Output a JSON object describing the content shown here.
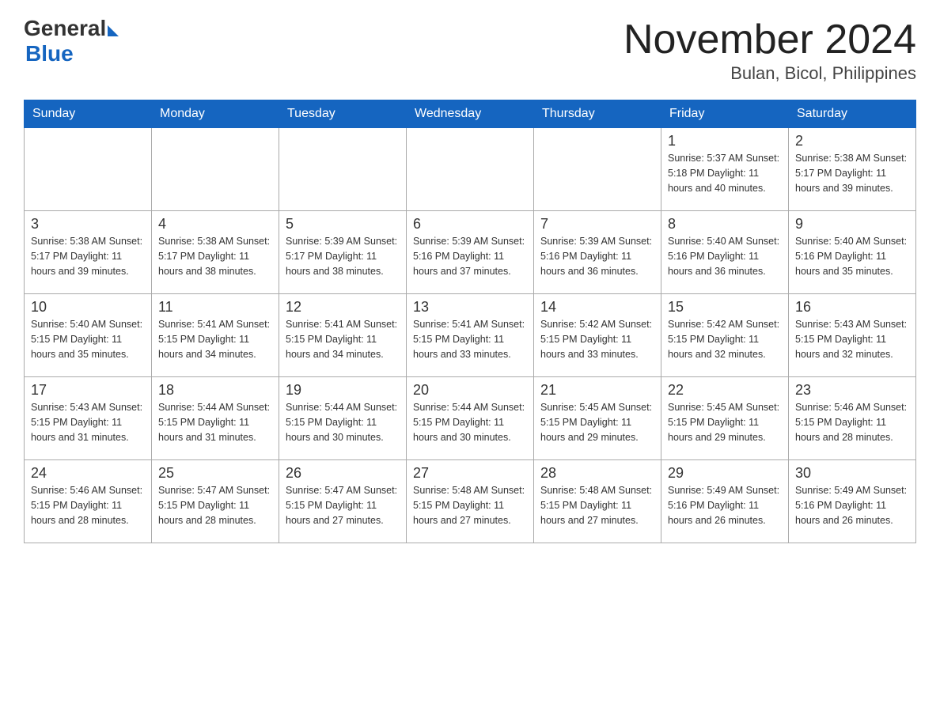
{
  "logo": {
    "general": "General",
    "blue": "Blue"
  },
  "header": {
    "month": "November 2024",
    "location": "Bulan, Bicol, Philippines"
  },
  "days_of_week": [
    "Sunday",
    "Monday",
    "Tuesday",
    "Wednesday",
    "Thursday",
    "Friday",
    "Saturday"
  ],
  "weeks": [
    [
      {
        "day": "",
        "info": ""
      },
      {
        "day": "",
        "info": ""
      },
      {
        "day": "",
        "info": ""
      },
      {
        "day": "",
        "info": ""
      },
      {
        "day": "",
        "info": ""
      },
      {
        "day": "1",
        "info": "Sunrise: 5:37 AM\nSunset: 5:18 PM\nDaylight: 11 hours and 40 minutes."
      },
      {
        "day": "2",
        "info": "Sunrise: 5:38 AM\nSunset: 5:17 PM\nDaylight: 11 hours and 39 minutes."
      }
    ],
    [
      {
        "day": "3",
        "info": "Sunrise: 5:38 AM\nSunset: 5:17 PM\nDaylight: 11 hours and 39 minutes."
      },
      {
        "day": "4",
        "info": "Sunrise: 5:38 AM\nSunset: 5:17 PM\nDaylight: 11 hours and 38 minutes."
      },
      {
        "day": "5",
        "info": "Sunrise: 5:39 AM\nSunset: 5:17 PM\nDaylight: 11 hours and 38 minutes."
      },
      {
        "day": "6",
        "info": "Sunrise: 5:39 AM\nSunset: 5:16 PM\nDaylight: 11 hours and 37 minutes."
      },
      {
        "day": "7",
        "info": "Sunrise: 5:39 AM\nSunset: 5:16 PM\nDaylight: 11 hours and 36 minutes."
      },
      {
        "day": "8",
        "info": "Sunrise: 5:40 AM\nSunset: 5:16 PM\nDaylight: 11 hours and 36 minutes."
      },
      {
        "day": "9",
        "info": "Sunrise: 5:40 AM\nSunset: 5:16 PM\nDaylight: 11 hours and 35 minutes."
      }
    ],
    [
      {
        "day": "10",
        "info": "Sunrise: 5:40 AM\nSunset: 5:15 PM\nDaylight: 11 hours and 35 minutes."
      },
      {
        "day": "11",
        "info": "Sunrise: 5:41 AM\nSunset: 5:15 PM\nDaylight: 11 hours and 34 minutes."
      },
      {
        "day": "12",
        "info": "Sunrise: 5:41 AM\nSunset: 5:15 PM\nDaylight: 11 hours and 34 minutes."
      },
      {
        "day": "13",
        "info": "Sunrise: 5:41 AM\nSunset: 5:15 PM\nDaylight: 11 hours and 33 minutes."
      },
      {
        "day": "14",
        "info": "Sunrise: 5:42 AM\nSunset: 5:15 PM\nDaylight: 11 hours and 33 minutes."
      },
      {
        "day": "15",
        "info": "Sunrise: 5:42 AM\nSunset: 5:15 PM\nDaylight: 11 hours and 32 minutes."
      },
      {
        "day": "16",
        "info": "Sunrise: 5:43 AM\nSunset: 5:15 PM\nDaylight: 11 hours and 32 minutes."
      }
    ],
    [
      {
        "day": "17",
        "info": "Sunrise: 5:43 AM\nSunset: 5:15 PM\nDaylight: 11 hours and 31 minutes."
      },
      {
        "day": "18",
        "info": "Sunrise: 5:44 AM\nSunset: 5:15 PM\nDaylight: 11 hours and 31 minutes."
      },
      {
        "day": "19",
        "info": "Sunrise: 5:44 AM\nSunset: 5:15 PM\nDaylight: 11 hours and 30 minutes."
      },
      {
        "day": "20",
        "info": "Sunrise: 5:44 AM\nSunset: 5:15 PM\nDaylight: 11 hours and 30 minutes."
      },
      {
        "day": "21",
        "info": "Sunrise: 5:45 AM\nSunset: 5:15 PM\nDaylight: 11 hours and 29 minutes."
      },
      {
        "day": "22",
        "info": "Sunrise: 5:45 AM\nSunset: 5:15 PM\nDaylight: 11 hours and 29 minutes."
      },
      {
        "day": "23",
        "info": "Sunrise: 5:46 AM\nSunset: 5:15 PM\nDaylight: 11 hours and 28 minutes."
      }
    ],
    [
      {
        "day": "24",
        "info": "Sunrise: 5:46 AM\nSunset: 5:15 PM\nDaylight: 11 hours and 28 minutes."
      },
      {
        "day": "25",
        "info": "Sunrise: 5:47 AM\nSunset: 5:15 PM\nDaylight: 11 hours and 28 minutes."
      },
      {
        "day": "26",
        "info": "Sunrise: 5:47 AM\nSunset: 5:15 PM\nDaylight: 11 hours and 27 minutes."
      },
      {
        "day": "27",
        "info": "Sunrise: 5:48 AM\nSunset: 5:15 PM\nDaylight: 11 hours and 27 minutes."
      },
      {
        "day": "28",
        "info": "Sunrise: 5:48 AM\nSunset: 5:15 PM\nDaylight: 11 hours and 27 minutes."
      },
      {
        "day": "29",
        "info": "Sunrise: 5:49 AM\nSunset: 5:16 PM\nDaylight: 11 hours and 26 minutes."
      },
      {
        "day": "30",
        "info": "Sunrise: 5:49 AM\nSunset: 5:16 PM\nDaylight: 11 hours and 26 minutes."
      }
    ]
  ]
}
